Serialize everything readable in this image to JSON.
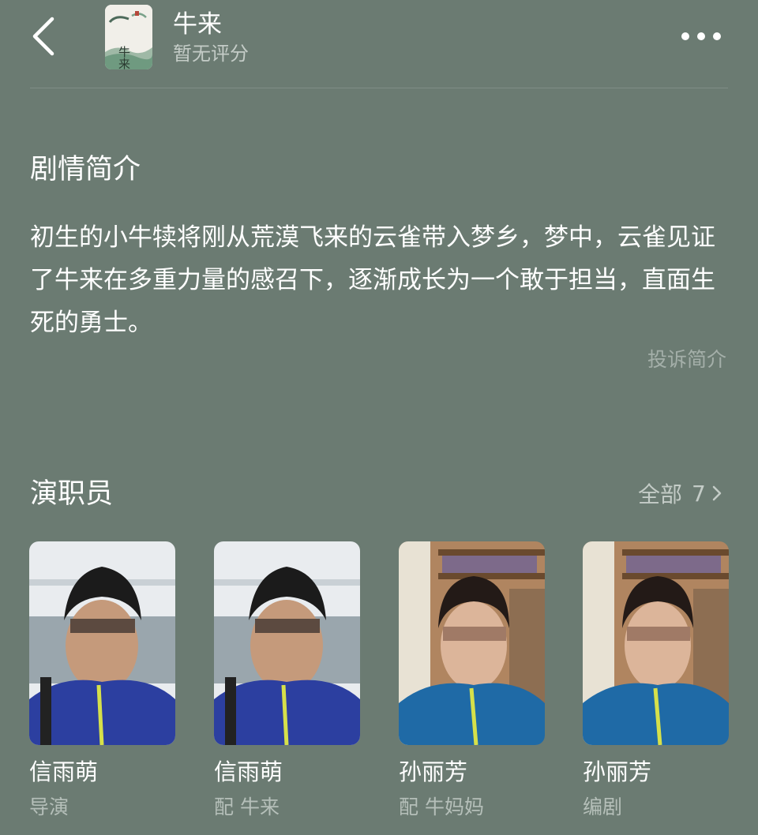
{
  "header": {
    "title": "牛来",
    "rating": "暂无评分",
    "poster_text": "牛来"
  },
  "synopsis": {
    "title": "剧情简介",
    "body": "初生的小牛犊将刚从荒漠飞来的云雀带入梦乡，梦中，云雀见证了牛来在多重力量的感召下，逐渐成长为一个敢于担当，直面生死的勇士。",
    "report_label": "投诉简介"
  },
  "cast": {
    "title": "演职员",
    "see_all_label": "全部",
    "count": "7",
    "members": [
      {
        "name": "信雨萌",
        "role": "导演"
      },
      {
        "name": "信雨萌",
        "role": "配 牛来"
      },
      {
        "name": "孙丽芳",
        "role": "配 牛妈妈"
      },
      {
        "name": "孙丽芳",
        "role": "编剧"
      }
    ]
  },
  "colors": {
    "background": "#6b7b72",
    "text_primary": "#ffffff",
    "text_secondary": "#c4ccc7",
    "text_muted": "#a4afa9"
  },
  "icons": {
    "back": "chevron-left-icon",
    "more": "more-dots-icon",
    "see_all": "chevron-right-icon"
  }
}
